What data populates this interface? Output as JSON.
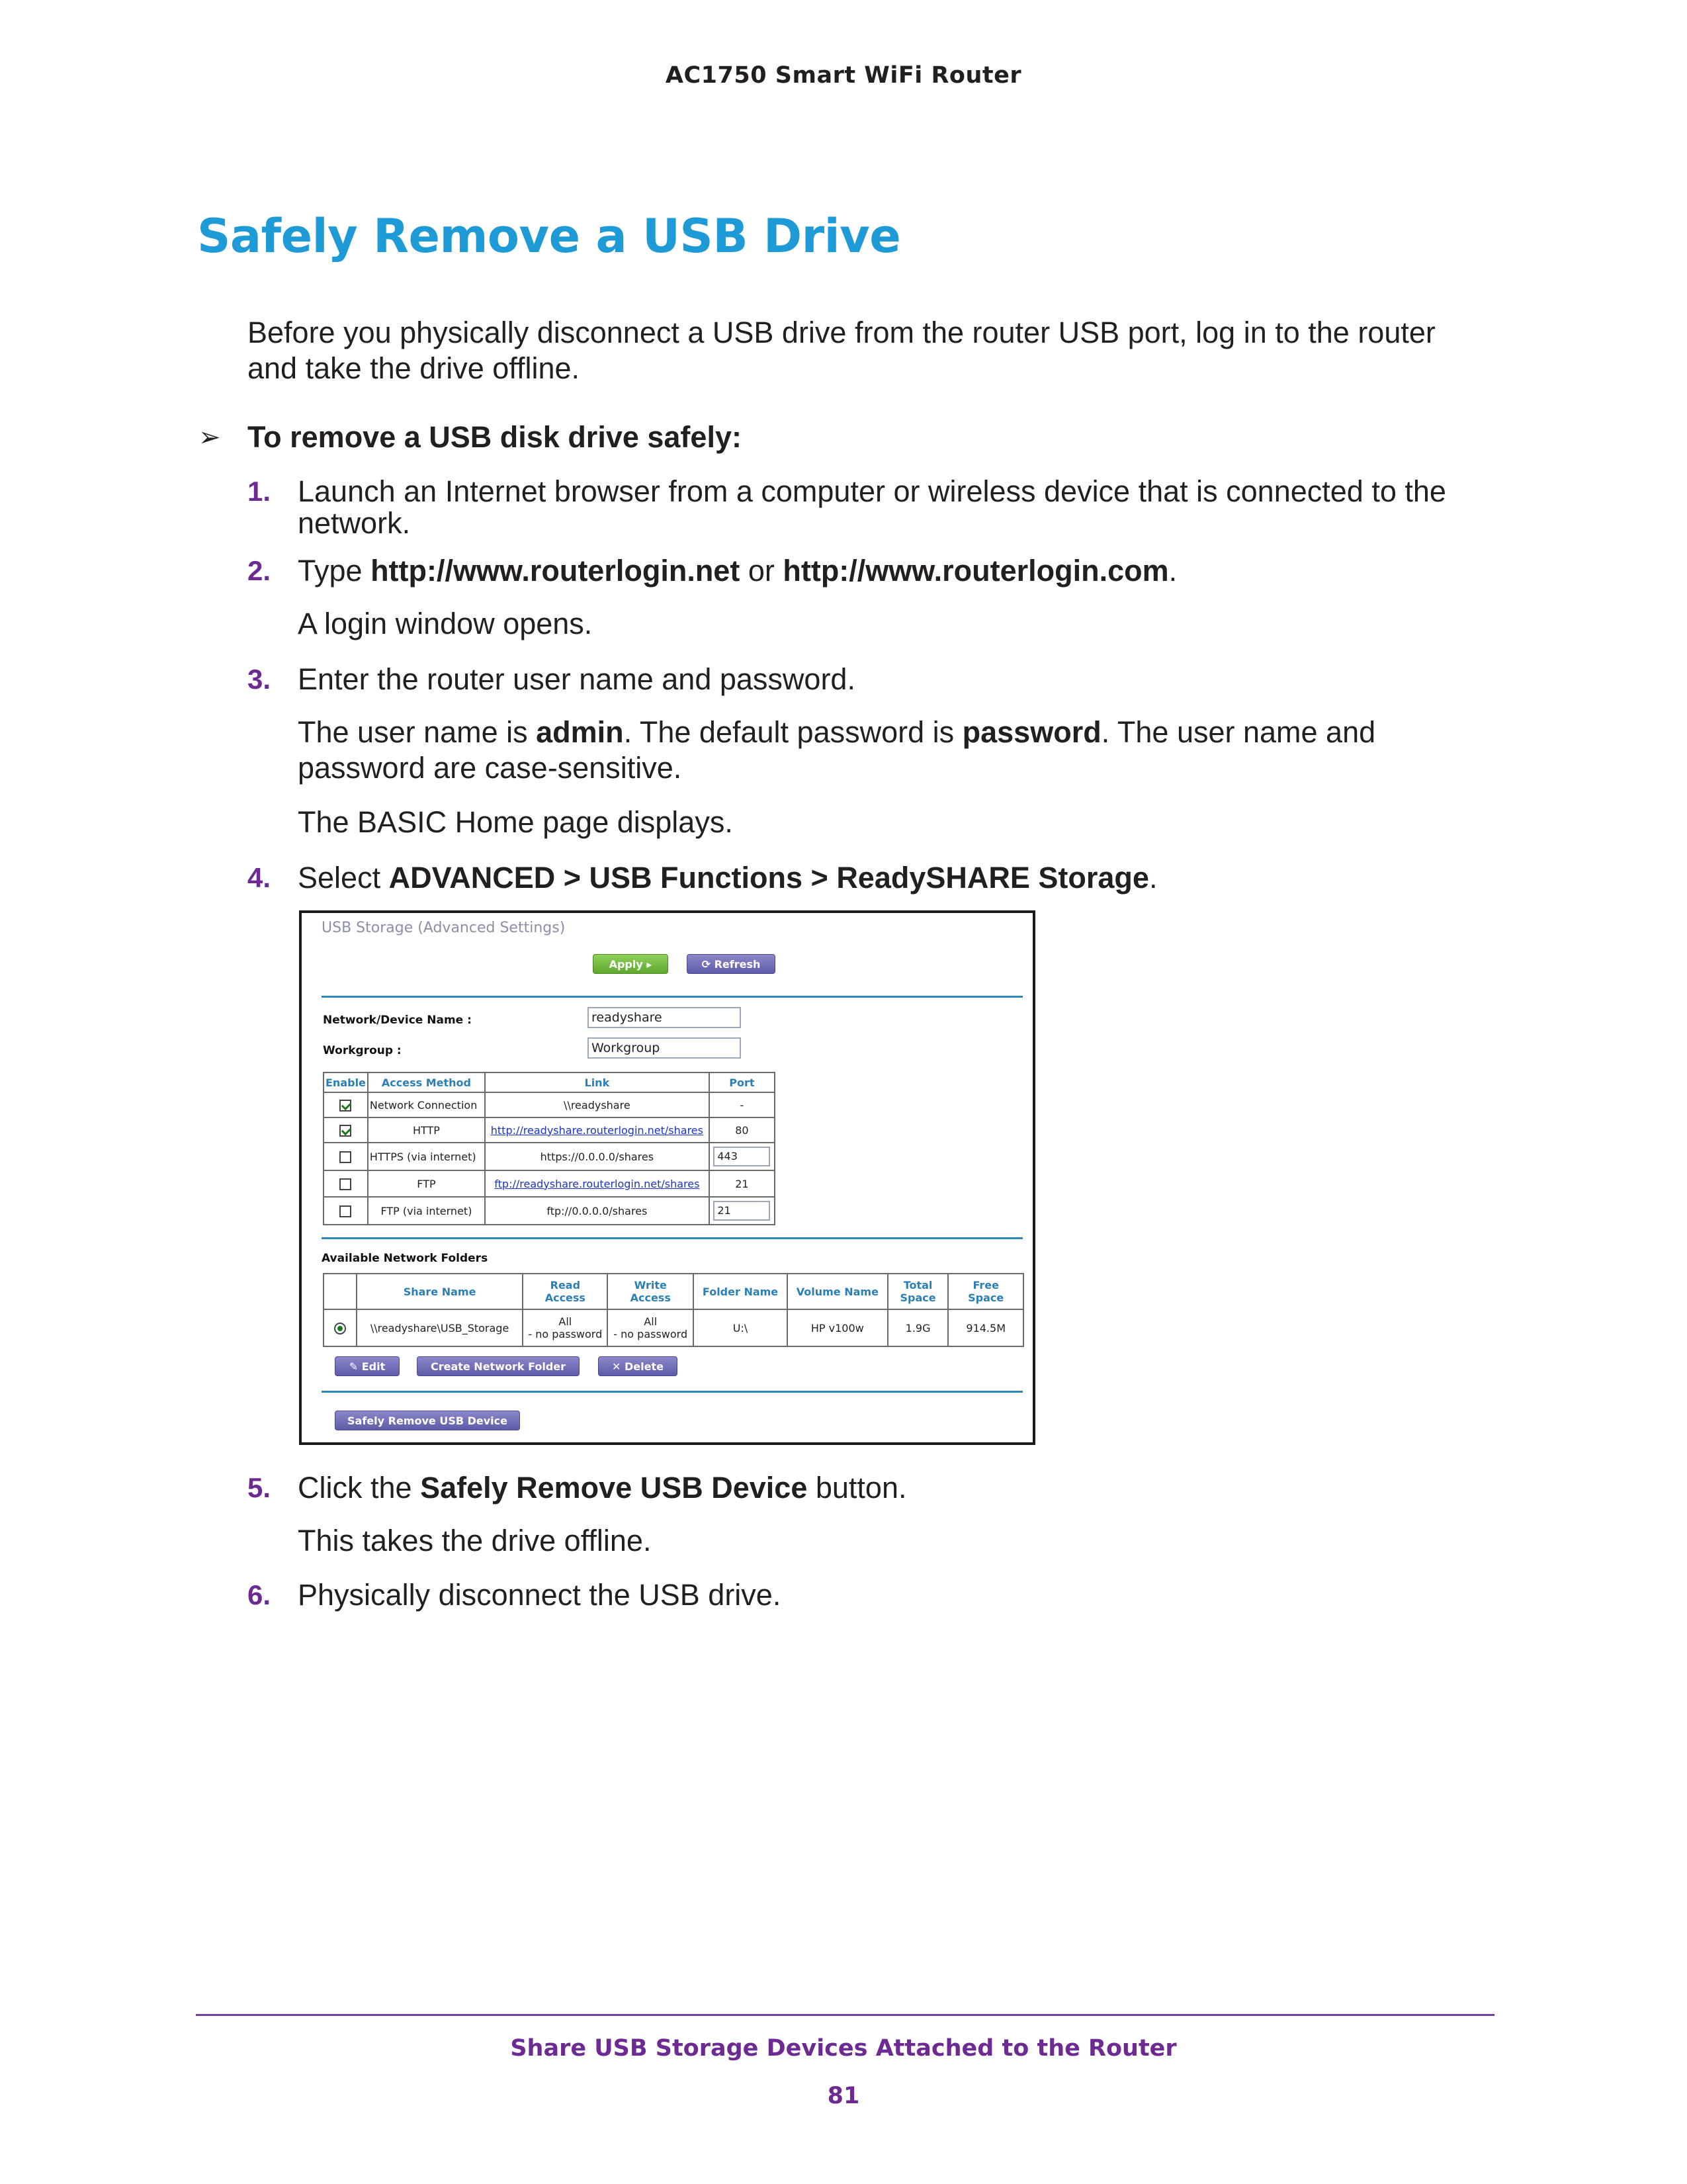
{
  "header": {
    "running_title": "AC1750 Smart WiFi Router"
  },
  "section": {
    "title": "Safely Remove a USB Drive"
  },
  "intro": {
    "line1": "Before you physically disconnect a USB drive from the router USB port, log in to the router",
    "line2": "and take the drive offline."
  },
  "procedure": {
    "heading": "To remove a USB disk drive safely:"
  },
  "steps": {
    "s1": {
      "num": "1.",
      "line1": "Launch an Internet browser from a computer or wireless device that is connected to the",
      "line2": "network."
    },
    "s2": {
      "num": "2.",
      "pre": "Type ",
      "url1": "http://www.routerlogin.net",
      "mid": " or ",
      "url2": "http://www.routerlogin.com",
      "post": ".",
      "note": "A login window opens."
    },
    "s3": {
      "num": "3.",
      "text": "Enter the router user name and password.",
      "p_pre": "The user name is ",
      "p_user": "admin",
      "p_mid": ". The default password is ",
      "p_pass": "password",
      "p_post": ". The user name and",
      "p_line2": "password are case-sensitive.",
      "note": "The BASIC Home page displays."
    },
    "s4": {
      "num": "4.",
      "pre": "Select ",
      "path": "ADVANCED > USB Functions > ReadySHARE Storage",
      "post": "."
    },
    "s5": {
      "num": "5.",
      "pre": "Click the ",
      "btn": "Safely Remove USB Device",
      "post": " button.",
      "note": "This takes the drive offline."
    },
    "s6": {
      "num": "6.",
      "text": "Physically disconnect the USB drive."
    }
  },
  "screenshot": {
    "title": "USB Storage (Advanced Settings)",
    "apply_label": "Apply ▸",
    "refresh_label": "⟳ Refresh",
    "device_name_label": "Network/Device Name :",
    "device_name_value": "readyshare",
    "workgroup_label": "Workgroup :",
    "workgroup_value": "Workgroup",
    "access_headers": [
      "Enable",
      "Access Method",
      "Link",
      "Port"
    ],
    "access_rows": [
      {
        "method": "Network Connection",
        "link": "\\\\readyshare",
        "port": "-"
      },
      {
        "method": "HTTP",
        "link": "http://readyshare.routerlogin.net/shares",
        "port": "80"
      },
      {
        "method": "HTTPS (via internet)",
        "link": "https://0.0.0.0/shares",
        "port": "443"
      },
      {
        "method": "FTP",
        "link": "ftp://readyshare.routerlogin.net/shares",
        "port": "21"
      },
      {
        "method": "FTP (via internet)",
        "link": "ftp://0.0.0.0/shares",
        "port": "21"
      }
    ],
    "folders_label": "Available Network Folders",
    "folder_headers": {
      "share": "Share Name",
      "read1": "Read",
      "read2": "Access",
      "write1": "Write",
      "write2": "Access",
      "folder": "Folder Name",
      "volume": "Volume Name",
      "total1": "Total",
      "total2": "Space",
      "free1": "Free",
      "free2": "Space"
    },
    "folder_row": {
      "share": "\\\\readyshare\\USB_Storage",
      "read1": "All",
      "read2": "- no password",
      "write1": "All",
      "write2": "- no password",
      "folder": "U:\\",
      "volume": "HP v100w",
      "total": "1.9G",
      "free": "914.5M"
    },
    "edit_label": "✎ Edit",
    "create_label": "Create Network Folder",
    "delete_label": "✕ Delete",
    "safely_remove_label": "Safely Remove USB Device"
  },
  "footer": {
    "chapter": "Share USB Storage Devices Attached to the Router",
    "page": "81"
  },
  "colors": {
    "title": "#1e9ad6",
    "accent": "#6c2a92",
    "text": "#231f20"
  }
}
